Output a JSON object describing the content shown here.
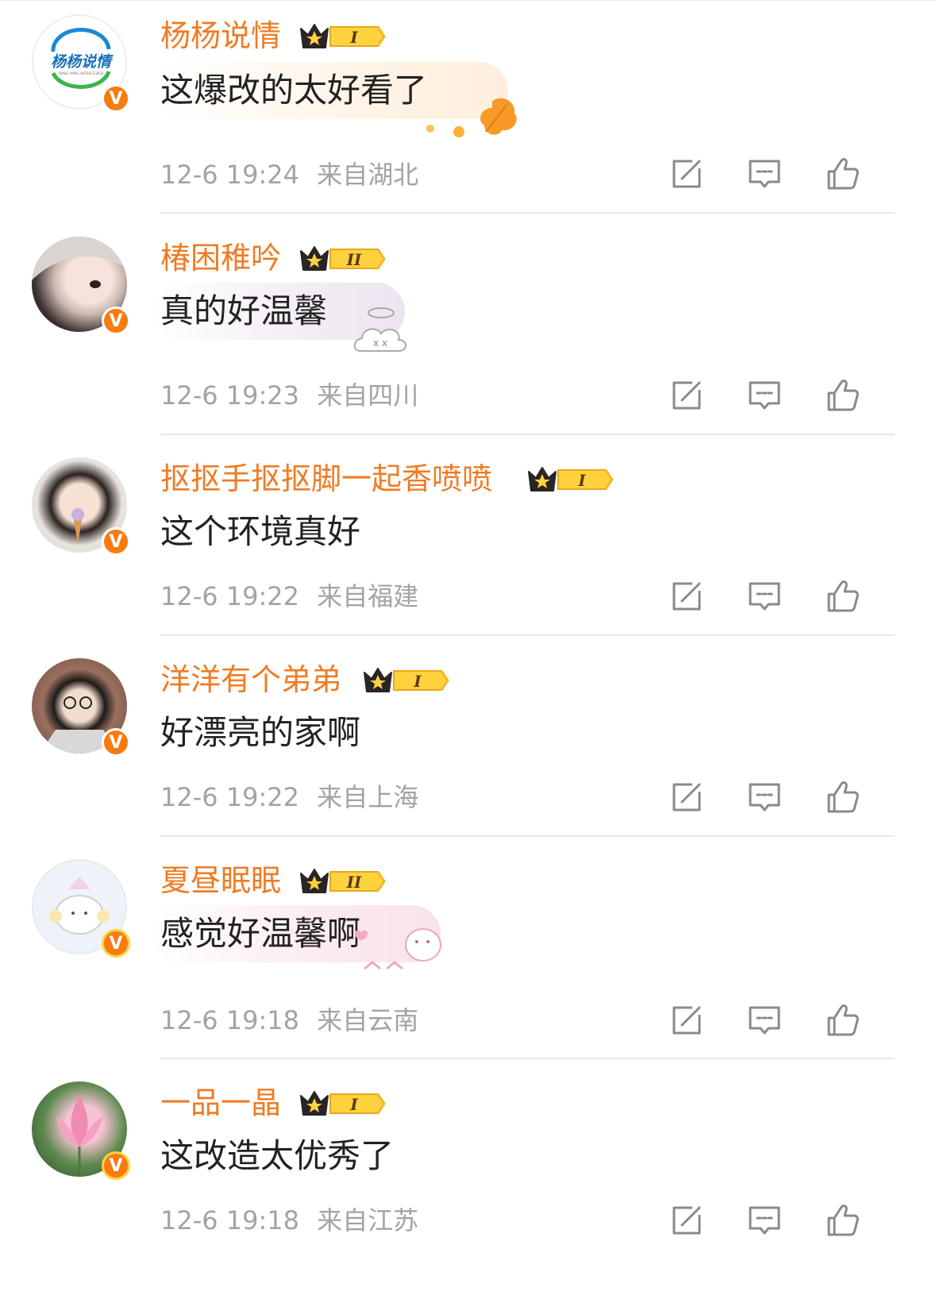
{
  "badge_letter": "V",
  "colors": {
    "name": "#f07b24",
    "verified": "#f77b0f",
    "meta": "#a3a3a3",
    "text": "#222222"
  },
  "avatar_texts": {
    "brand_main": "杨杨说情",
    "brand_sub": "YANG YANG INTERCEDED"
  },
  "comments": [
    {
      "name": "杨杨说情",
      "level": "I",
      "text": "这爆改的太好看了",
      "time": "12-6 19:24",
      "location": "来自湖北",
      "icons": [
        "share-icon",
        "comment-icon",
        "like-icon"
      ]
    },
    {
      "name": "椿困稚吟",
      "level": "II",
      "text": "真的好温馨",
      "time": "12-6 19:23",
      "location": "来自四川",
      "icons": [
        "share-icon",
        "comment-icon",
        "like-icon"
      ]
    },
    {
      "name": "抠抠手抠抠脚一起香喷喷",
      "level": "I",
      "text": "这个环境真好",
      "time": "12-6 19:22",
      "location": "来自福建",
      "icons": [
        "share-icon",
        "comment-icon",
        "like-icon"
      ]
    },
    {
      "name": "洋洋有个弟弟",
      "level": "I",
      "text": "好漂亮的家啊",
      "time": "12-6 19:22",
      "location": "来自上海",
      "icons": [
        "share-icon",
        "comment-icon",
        "like-icon"
      ]
    },
    {
      "name": "夏昼眠眠",
      "level": "II",
      "text": "感觉好温馨啊",
      "time": "12-6 19:18",
      "location": "来自云南",
      "icons": [
        "share-icon",
        "comment-icon",
        "like-icon"
      ]
    },
    {
      "name": "一品一晶",
      "level": "I",
      "text": "这改造太优秀了",
      "time": "12-6 19:18",
      "location": "来自江苏",
      "icons": [
        "share-icon",
        "comment-icon",
        "like-icon"
      ]
    }
  ]
}
